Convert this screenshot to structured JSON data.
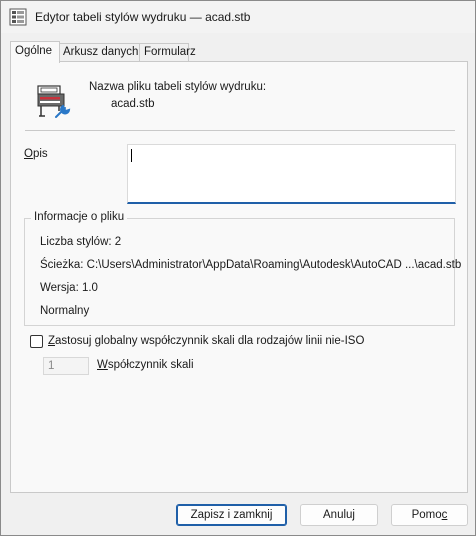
{
  "window": {
    "title": "Edytor tabeli stylów wydruku — acad.stb",
    "icons": {
      "app": "plot-style-table-icon",
      "file": "plotter-settings-icon"
    }
  },
  "tabs": [
    {
      "label": "Ogólne",
      "active": true
    },
    {
      "label": "Arkusz danych",
      "active": false
    },
    {
      "label": "Formularz",
      "active": false
    }
  ],
  "general": {
    "filename_label": "Nazwa pliku tabeli stylów wydruku:",
    "filename_value": "acad.stb",
    "description": {
      "label_underlined": "O",
      "label_rest": "pis",
      "value": ""
    },
    "file_info": {
      "legend": "Informacje o pliku",
      "style_count": "Liczba stylów: 2",
      "path": "Ścieżka: C:\\Users\\Administrator\\AppData\\Roaming\\Autodesk\\AutoCAD ...\\acad.stb",
      "version": "Wersja: 1.0",
      "type": "Normalny"
    },
    "global_scale": {
      "checkbox_underlined": "Z",
      "checkbox_rest": "astosuj globalny współczynnik skali dla rodzajów linii nie-ISO",
      "checked": false,
      "factor_value": "1",
      "factor_label_underlined": "W",
      "factor_label_rest": "spółczynnik skali"
    }
  },
  "buttons": {
    "save_close": "Zapisz i zamknij",
    "cancel": "Anuluj",
    "help_main": "Pomo",
    "help_underlined": "c"
  },
  "colors": {
    "accent": "#1f5fa8",
    "icon_red": "#c8323c",
    "icon_blue": "#2a78c8"
  }
}
